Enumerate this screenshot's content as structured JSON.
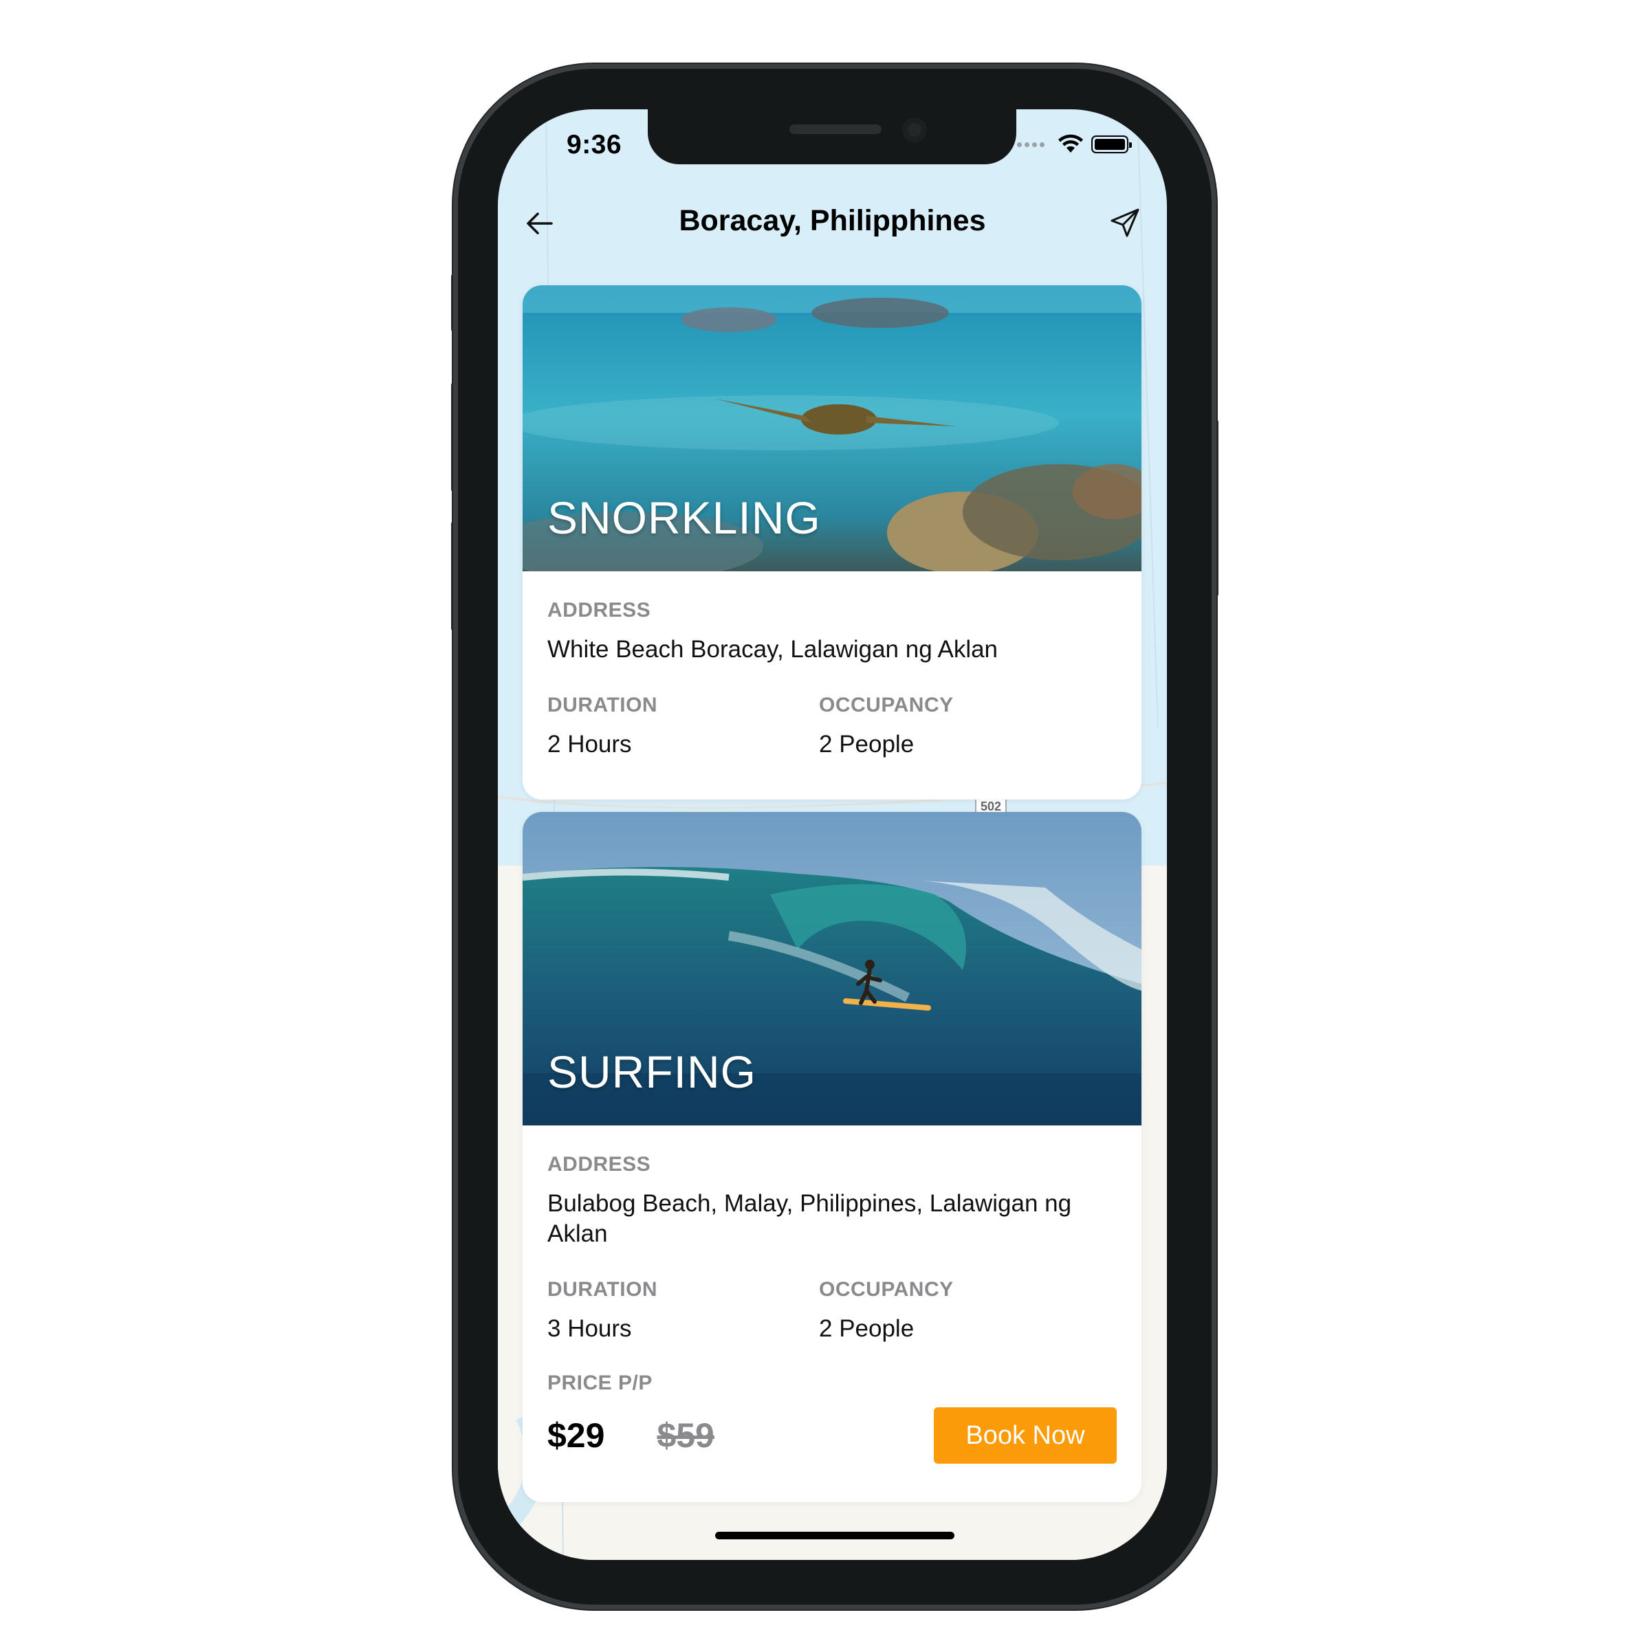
{
  "status_bar": {
    "time": "9:36"
  },
  "header": {
    "title": "Boracay, Philipphines"
  },
  "map": {
    "road_label": "502"
  },
  "activities": [
    {
      "title": "SNORKLING",
      "address_label": "ADDRESS",
      "address": "White Beach Boracay, Lalawigan ng Aklan",
      "duration_label": "DURATION",
      "duration": "2 Hours",
      "occupancy_label": "OCCUPANCY",
      "occupancy": "2 People"
    },
    {
      "title": "SURFING",
      "address_label": "ADDRESS",
      "address": "Bulabog Beach, Malay, Philippines, Lalawigan ng Aklan",
      "duration_label": "DURATION",
      "duration": "3 Hours",
      "occupancy_label": "OCCUPANCY",
      "occupancy": "2 People",
      "price_label": "PRICE P/P",
      "price": "$29",
      "original_price": "$59",
      "book_label": "Book Now"
    }
  ],
  "colors": {
    "accent": "#fb9b0a",
    "map_water": "#d8eef8",
    "label_gray": "#8a8a8e"
  },
  "icons": {
    "back": "arrow-left-icon",
    "share": "send-icon",
    "wifi": "wifi-icon",
    "battery": "battery-icon"
  }
}
